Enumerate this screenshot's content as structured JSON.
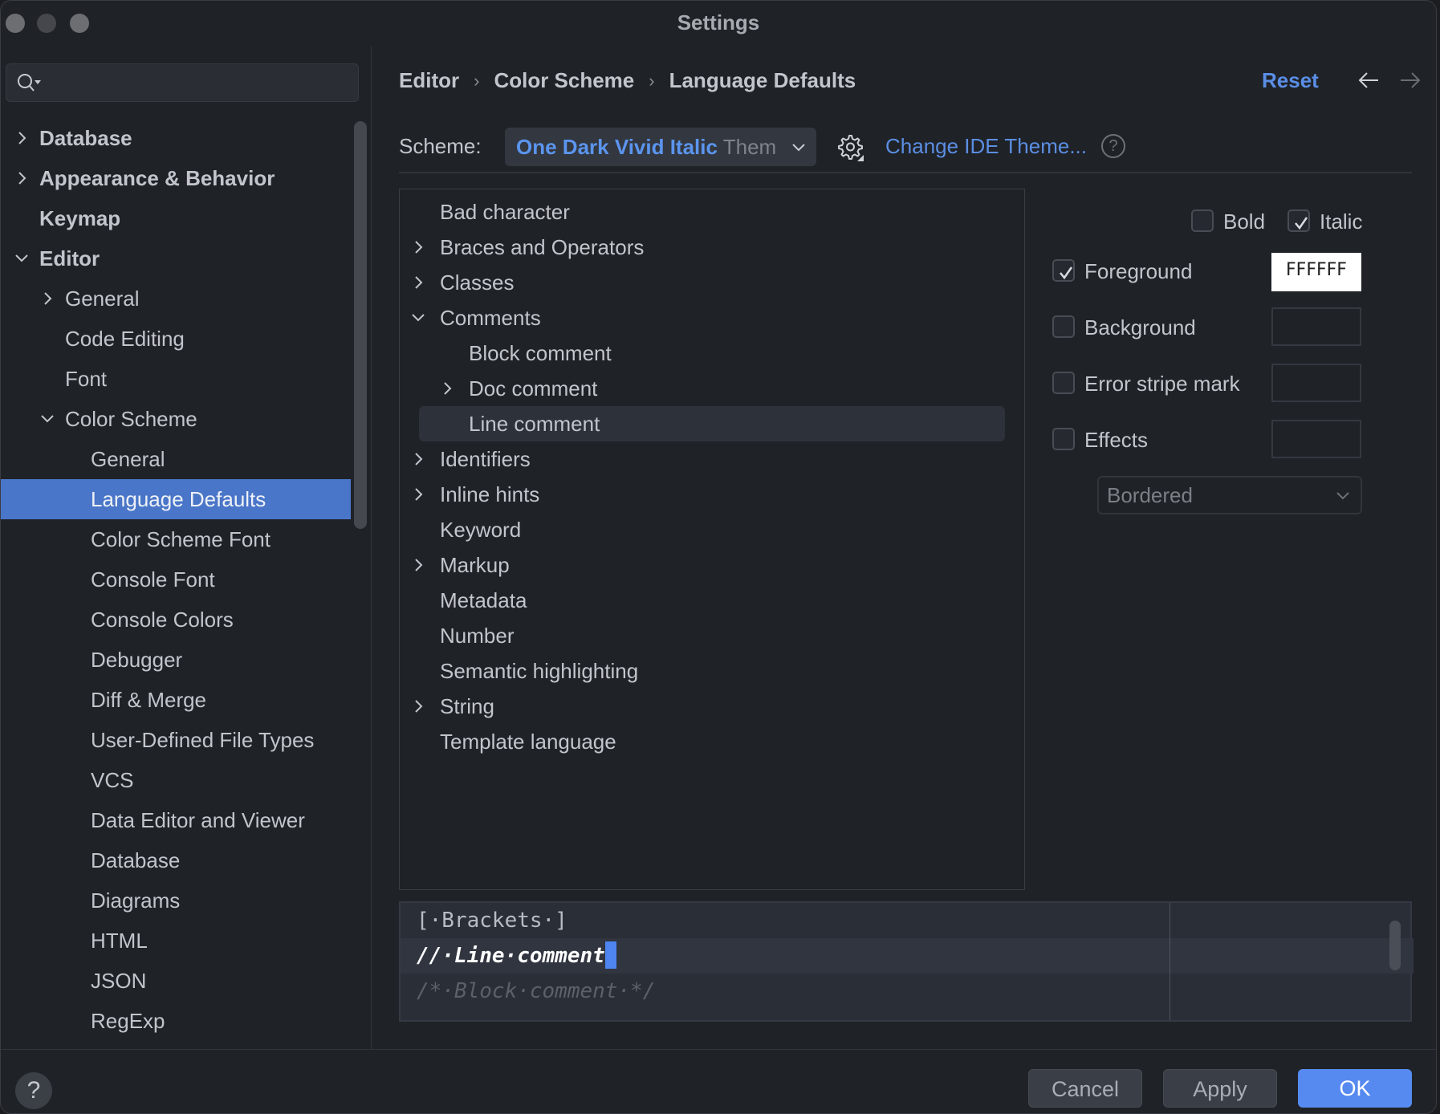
{
  "window": {
    "title": "Settings",
    "controls": [
      "close",
      "minimize",
      "maximize"
    ]
  },
  "sidebar": {
    "search": {
      "placeholder": "",
      "value": "",
      "icon": "search-icon"
    },
    "items": [
      {
        "label": "Database",
        "level": 0,
        "expander": "collapsed",
        "bold": true
      },
      {
        "label": "Appearance & Behavior",
        "level": 0,
        "expander": "collapsed",
        "bold": true
      },
      {
        "label": "Keymap",
        "level": 0,
        "expander": "none",
        "bold": true
      },
      {
        "label": "Editor",
        "level": 0,
        "expander": "expanded",
        "bold": true
      },
      {
        "label": "General",
        "level": 1,
        "expander": "collapsed"
      },
      {
        "label": "Code Editing",
        "level": 1,
        "expander": "none"
      },
      {
        "label": "Font",
        "level": 1,
        "expander": "none"
      },
      {
        "label": "Color Scheme",
        "level": 1,
        "expander": "expanded"
      },
      {
        "label": "General",
        "level": 2,
        "expander": "none"
      },
      {
        "label": "Language Defaults",
        "level": 2,
        "expander": "none",
        "selected": true
      },
      {
        "label": "Color Scheme Font",
        "level": 2,
        "expander": "none"
      },
      {
        "label": "Console Font",
        "level": 2,
        "expander": "none"
      },
      {
        "label": "Console Colors",
        "level": 2,
        "expander": "none"
      },
      {
        "label": "Debugger",
        "level": 2,
        "expander": "none"
      },
      {
        "label": "Diff & Merge",
        "level": 2,
        "expander": "none"
      },
      {
        "label": "User-Defined File Types",
        "level": 2,
        "expander": "none"
      },
      {
        "label": "VCS",
        "level": 2,
        "expander": "none"
      },
      {
        "label": "Data Editor and Viewer",
        "level": 2,
        "expander": "none"
      },
      {
        "label": "Database",
        "level": 2,
        "expander": "none"
      },
      {
        "label": "Diagrams",
        "level": 2,
        "expander": "none"
      },
      {
        "label": "HTML",
        "level": 2,
        "expander": "none"
      },
      {
        "label": "JSON",
        "level": 2,
        "expander": "none"
      },
      {
        "label": "RegExp",
        "level": 2,
        "expander": "none"
      }
    ]
  },
  "header": {
    "breadcrumb": [
      "Editor",
      "Color Scheme",
      "Language Defaults"
    ],
    "breadcrumb_separator": "›",
    "reset_label": "Reset",
    "back_icon": "arrow-left-icon",
    "forward_icon": "arrow-right-icon"
  },
  "scheme": {
    "label": "Scheme:",
    "selected_name": "One Dark Vivid Italic",
    "selected_suffix": "Them",
    "change_theme_link": "Change IDE Theme...",
    "help_glyph": "?"
  },
  "attributes": {
    "items": [
      {
        "label": "Bad character",
        "level": 0,
        "expander": "none"
      },
      {
        "label": "Braces and Operators",
        "level": 0,
        "expander": "collapsed"
      },
      {
        "label": "Classes",
        "level": 0,
        "expander": "collapsed"
      },
      {
        "label": "Comments",
        "level": 0,
        "expander": "expanded"
      },
      {
        "label": "Block comment",
        "level": 1,
        "expander": "none"
      },
      {
        "label": "Doc comment",
        "level": 1,
        "expander": "collapsed"
      },
      {
        "label": "Line comment",
        "level": 1,
        "expander": "none",
        "selected": true
      },
      {
        "label": "Identifiers",
        "level": 0,
        "expander": "collapsed"
      },
      {
        "label": "Inline hints",
        "level": 0,
        "expander": "collapsed"
      },
      {
        "label": "Keyword",
        "level": 0,
        "expander": "none"
      },
      {
        "label": "Markup",
        "level": 0,
        "expander": "collapsed"
      },
      {
        "label": "Metadata",
        "level": 0,
        "expander": "none"
      },
      {
        "label": "Number",
        "level": 0,
        "expander": "none"
      },
      {
        "label": "Semantic highlighting",
        "level": 0,
        "expander": "none"
      },
      {
        "label": "String",
        "level": 0,
        "expander": "collapsed"
      },
      {
        "label": "Template language",
        "level": 0,
        "expander": "none"
      }
    ]
  },
  "options": {
    "bold": {
      "label": "Bold",
      "checked": false
    },
    "italic": {
      "label": "Italic",
      "checked": true
    },
    "foreground": {
      "label": "Foreground",
      "checked": true,
      "value": "FFFFFF",
      "color": "#FFFFFF"
    },
    "background": {
      "label": "Background",
      "checked": false,
      "value": ""
    },
    "error_stripe": {
      "label": "Error stripe mark",
      "checked": false,
      "value": ""
    },
    "effects": {
      "label": "Effects",
      "checked": false,
      "value": ""
    },
    "effect_type": {
      "selected": "Bordered",
      "enabled": false
    }
  },
  "preview": {
    "lines": [
      {
        "text": "[·Brackets·]",
        "style": "bracket"
      },
      {
        "text": "//·Line·comment",
        "style": "line-comment",
        "current": true
      },
      {
        "text": "/*·Block·comment·*/",
        "style": "block-comment"
      }
    ]
  },
  "footer": {
    "help_glyph": "?",
    "cancel_label": "Cancel",
    "apply_label": "Apply",
    "ok_label": "OK"
  },
  "colors": {
    "accent": "#4A76C9",
    "link": "#5B8EE3",
    "ok_button": "#578AF0",
    "caret": "#4D84F0"
  }
}
